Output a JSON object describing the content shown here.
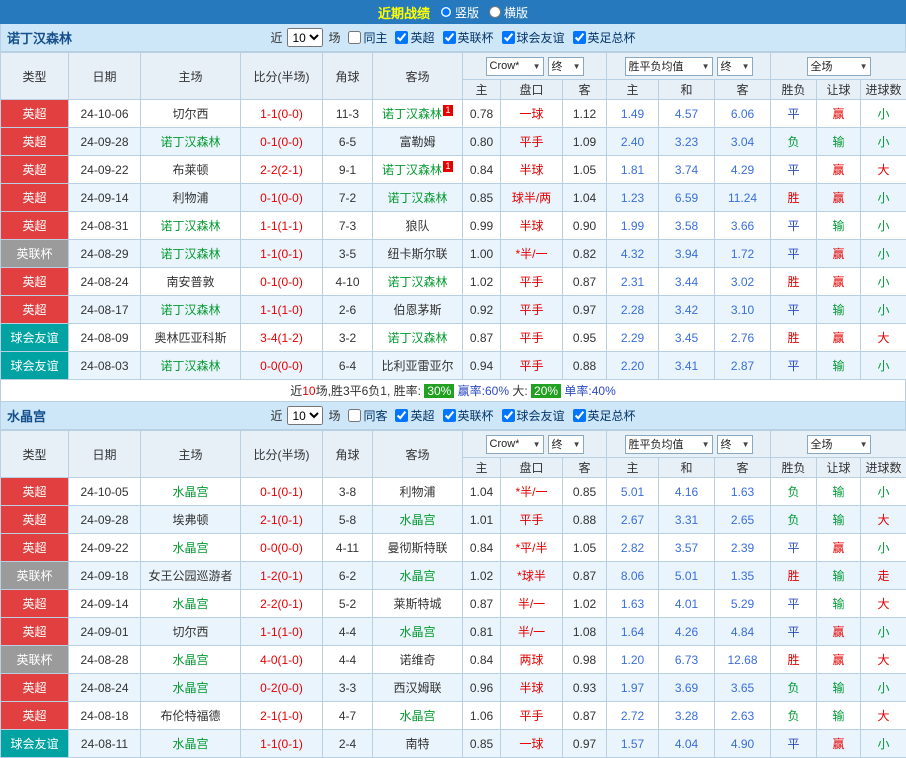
{
  "top_bar": {
    "title": "近期战绩",
    "options": [
      {
        "label": "竖版",
        "selected": true
      },
      {
        "label": "横版",
        "selected": false
      }
    ]
  },
  "table_header": {
    "static_cols": [
      "类型",
      "日期",
      "主场",
      "比分(半场)",
      "角球",
      "客场"
    ],
    "odds_source_select": "Crow*",
    "final_select": "终",
    "odds_sub": [
      "主",
      "盘口",
      "客"
    ],
    "avg_select": "胜平负均值",
    "avg_sub": [
      "主",
      "和",
      "客"
    ],
    "scope_select": "全场",
    "result_sub": [
      "胜负",
      "让球",
      "进球数"
    ]
  },
  "type_colors": {
    "英超": {
      "bg": "#e24040",
      "fg": "#ffffff"
    },
    "英联杯": {
      "bg": "#9b9b9b",
      "fg": "#ffffff"
    },
    "球会友谊": {
      "bg": "#00a2a2",
      "fg": "#ffffff"
    }
  },
  "result_colors": {
    "胜": "#e60000",
    "平": "#2b49c3",
    "负": "#019934",
    "赢": "#e60000",
    "输": "#019934",
    "大": "#e60000",
    "小": "#019934",
    "走": "#e60000"
  },
  "colors": {
    "focus_team": "#029a2f",
    "normal_team": "#333333"
  },
  "sections": [
    {
      "team": "诺丁汉森林",
      "filter": {
        "prefix": "近",
        "count": "10",
        "suffix": "场",
        "venue": {
          "label": "同主",
          "checked": false
        },
        "competitions": [
          {
            "label": "英超",
            "checked": true
          },
          {
            "label": "英联杯",
            "checked": true
          },
          {
            "label": "球会友谊",
            "checked": true
          },
          {
            "label": "英足总杯",
            "checked": true
          }
        ]
      },
      "rows": [
        {
          "type": "英超",
          "date": "24-10-06",
          "home": "切尔西",
          "home_focus": false,
          "score": "1-1(0-0)",
          "corner": "11-3",
          "away": "诺丁汉森林",
          "away_focus": true,
          "away_sup": "1",
          "odds": [
            "0.78",
            "一球",
            "1.12"
          ],
          "avg": [
            "1.49",
            "4.57",
            "6.06"
          ],
          "res": [
            "平",
            "赢",
            "小"
          ]
        },
        {
          "type": "英超",
          "date": "24-09-28",
          "home": "诺丁汉森林",
          "home_focus": true,
          "score": "0-1(0-0)",
          "corner": "6-5",
          "away": "富勒姆",
          "away_focus": false,
          "odds": [
            "0.80",
            "平手",
            "1.09"
          ],
          "avg": [
            "2.40",
            "3.23",
            "3.04"
          ],
          "res": [
            "负",
            "输",
            "小"
          ]
        },
        {
          "type": "英超",
          "date": "24-09-22",
          "home": "布莱顿",
          "home_focus": false,
          "score": "2-2(2-1)",
          "corner": "9-1",
          "away": "诺丁汉森林",
          "away_focus": true,
          "away_sup": "1",
          "odds": [
            "0.84",
            "半球",
            "1.05"
          ],
          "avg": [
            "1.81",
            "3.74",
            "4.29"
          ],
          "res": [
            "平",
            "赢",
            "大"
          ]
        },
        {
          "type": "英超",
          "date": "24-09-14",
          "home": "利物浦",
          "home_focus": false,
          "score": "0-1(0-0)",
          "corner": "7-2",
          "away": "诺丁汉森林",
          "away_focus": true,
          "odds": [
            "0.85",
            "球半/两",
            "1.04"
          ],
          "avg": [
            "1.23",
            "6.59",
            "11.24"
          ],
          "res": [
            "胜",
            "赢",
            "小"
          ]
        },
        {
          "type": "英超",
          "date": "24-08-31",
          "home": "诺丁汉森林",
          "home_focus": true,
          "score": "1-1(1-1)",
          "corner": "7-3",
          "away": "狼队",
          "away_focus": false,
          "odds": [
            "0.99",
            "半球",
            "0.90"
          ],
          "avg": [
            "1.99",
            "3.58",
            "3.66"
          ],
          "res": [
            "平",
            "输",
            "小"
          ]
        },
        {
          "type": "英联杯",
          "date": "24-08-29",
          "home": "诺丁汉森林",
          "home_focus": true,
          "score": "1-1(0-1)",
          "corner": "3-5",
          "away": "纽卡斯尔联",
          "away_focus": false,
          "odds": [
            "1.00",
            "*半/一",
            "0.82"
          ],
          "avg": [
            "4.32",
            "3.94",
            "1.72"
          ],
          "res": [
            "平",
            "赢",
            "小"
          ]
        },
        {
          "type": "英超",
          "date": "24-08-24",
          "home": "南安普敦",
          "home_focus": false,
          "score": "0-1(0-0)",
          "corner": "4-10",
          "away": "诺丁汉森林",
          "away_focus": true,
          "odds": [
            "1.02",
            "平手",
            "0.87"
          ],
          "avg": [
            "2.31",
            "3.44",
            "3.02"
          ],
          "res": [
            "胜",
            "赢",
            "小"
          ]
        },
        {
          "type": "英超",
          "date": "24-08-17",
          "home": "诺丁汉森林",
          "home_focus": true,
          "score": "1-1(1-0)",
          "corner": "2-6",
          "away": "伯恩茅斯",
          "away_focus": false,
          "odds": [
            "0.92",
            "平手",
            "0.97"
          ],
          "avg": [
            "2.28",
            "3.42",
            "3.10"
          ],
          "res": [
            "平",
            "输",
            "小"
          ]
        },
        {
          "type": "球会友谊",
          "date": "24-08-09",
          "home": "奥林匹亚科斯",
          "home_focus": false,
          "score": "3-4(1-2)",
          "corner": "3-2",
          "away": "诺丁汉森林",
          "away_focus": true,
          "odds": [
            "0.87",
            "平手",
            "0.95"
          ],
          "avg": [
            "2.29",
            "3.45",
            "2.76"
          ],
          "res": [
            "胜",
            "赢",
            "大"
          ]
        },
        {
          "type": "球会友谊",
          "date": "24-08-03",
          "home": "诺丁汉森林",
          "home_focus": true,
          "score": "0-0(0-0)",
          "corner": "6-4",
          "away": "比利亚雷亚尔",
          "away_focus": false,
          "odds": [
            "0.94",
            "平手",
            "0.88"
          ],
          "avg": [
            "2.20",
            "3.41",
            "2.87"
          ],
          "res": [
            "平",
            "输",
            "小"
          ]
        }
      ],
      "summary": [
        {
          "text": "近",
          "color": "#333333"
        },
        {
          "text": "10",
          "color": "#e60000"
        },
        {
          "text": "场,胜3平6负1, 胜率: ",
          "color": "#333333"
        },
        {
          "text": "30%",
          "color": "#ffffff",
          "bg": "#21a021"
        },
        {
          "text": " 赢率:60% ",
          "color": "#2b49c3"
        },
        {
          "text": "大: ",
          "color": "#333333"
        },
        {
          "text": "20%",
          "color": "#ffffff",
          "bg": "#21a021"
        },
        {
          "text": " 单率:40%",
          "color": "#2b49c3"
        }
      ]
    },
    {
      "team": "水晶宫",
      "filter": {
        "prefix": "近",
        "count": "10",
        "suffix": "场",
        "venue": {
          "label": "同客",
          "checked": false
        },
        "competitions": [
          {
            "label": "英超",
            "checked": true
          },
          {
            "label": "英联杯",
            "checked": true
          },
          {
            "label": "球会友谊",
            "checked": true
          },
          {
            "label": "英足总杯",
            "checked": true
          }
        ]
      },
      "rows": [
        {
          "type": "英超",
          "date": "24-10-05",
          "home": "水晶宫",
          "home_focus": true,
          "score": "0-1(0-1)",
          "corner": "3-8",
          "away": "利物浦",
          "away_focus": false,
          "odds": [
            "1.04",
            "*半/一",
            "0.85"
          ],
          "avg": [
            "5.01",
            "4.16",
            "1.63"
          ],
          "res": [
            "负",
            "输",
            "小"
          ]
        },
        {
          "type": "英超",
          "date": "24-09-28",
          "home": "埃弗顿",
          "home_focus": false,
          "score": "2-1(0-1)",
          "corner": "5-8",
          "away": "水晶宫",
          "away_focus": true,
          "odds": [
            "1.01",
            "平手",
            "0.88"
          ],
          "avg": [
            "2.67",
            "3.31",
            "2.65"
          ],
          "res": [
            "负",
            "输",
            "大"
          ]
        },
        {
          "type": "英超",
          "date": "24-09-22",
          "home": "水晶宫",
          "home_focus": true,
          "score": "0-0(0-0)",
          "corner": "4-11",
          "away": "曼彻斯特联",
          "away_focus": false,
          "odds": [
            "0.84",
            "*平/半",
            "1.05"
          ],
          "avg": [
            "2.82",
            "3.57",
            "2.39"
          ],
          "res": [
            "平",
            "赢",
            "小"
          ]
        },
        {
          "type": "英联杯",
          "date": "24-09-18",
          "home": "女王公园巡游者",
          "home_focus": false,
          "score": "1-2(0-1)",
          "corner": "6-2",
          "away": "水晶宫",
          "away_focus": true,
          "odds": [
            "1.02",
            "*球半",
            "0.87"
          ],
          "avg": [
            "8.06",
            "5.01",
            "1.35"
          ],
          "res": [
            "胜",
            "输",
            "走"
          ]
        },
        {
          "type": "英超",
          "date": "24-09-14",
          "home": "水晶宫",
          "home_focus": true,
          "score": "2-2(0-1)",
          "corner": "5-2",
          "away": "莱斯特城",
          "away_focus": false,
          "odds": [
            "0.87",
            "半/一",
            "1.02"
          ],
          "avg": [
            "1.63",
            "4.01",
            "5.29"
          ],
          "res": [
            "平",
            "输",
            "大"
          ]
        },
        {
          "type": "英超",
          "date": "24-09-01",
          "home": "切尔西",
          "home_focus": false,
          "score": "1-1(1-0)",
          "corner": "4-4",
          "away": "水晶宫",
          "away_focus": true,
          "odds": [
            "0.81",
            "半/一",
            "1.08"
          ],
          "avg": [
            "1.64",
            "4.26",
            "4.84"
          ],
          "res": [
            "平",
            "赢",
            "小"
          ]
        },
        {
          "type": "英联杯",
          "date": "24-08-28",
          "home": "水晶宫",
          "home_focus": true,
          "score": "4-0(1-0)",
          "corner": "4-4",
          "away": "诺维奇",
          "away_focus": false,
          "odds": [
            "0.84",
            "两球",
            "0.98"
          ],
          "avg": [
            "1.20",
            "6.73",
            "12.68"
          ],
          "res": [
            "胜",
            "赢",
            "大"
          ]
        },
        {
          "type": "英超",
          "date": "24-08-24",
          "home": "水晶宫",
          "home_focus": true,
          "score": "0-2(0-0)",
          "corner": "3-3",
          "away": "西汉姆联",
          "away_focus": false,
          "odds": [
            "0.96",
            "半球",
            "0.93"
          ],
          "avg": [
            "1.97",
            "3.69",
            "3.65"
          ],
          "res": [
            "负",
            "输",
            "小"
          ]
        },
        {
          "type": "英超",
          "date": "24-08-18",
          "home": "布伦特福德",
          "home_focus": false,
          "score": "2-1(1-0)",
          "corner": "4-7",
          "away": "水晶宫",
          "away_focus": true,
          "odds": [
            "1.06",
            "平手",
            "0.87"
          ],
          "avg": [
            "2.72",
            "3.28",
            "2.63"
          ],
          "res": [
            "负",
            "输",
            "大"
          ]
        },
        {
          "type": "球会友谊",
          "date": "24-08-11",
          "home": "水晶宫",
          "home_focus": true,
          "score": "1-1(0-1)",
          "corner": "2-4",
          "away": "南特",
          "away_focus": false,
          "odds": [
            "0.85",
            "一球",
            "0.97"
          ],
          "avg": [
            "1.57",
            "4.04",
            "4.90"
          ],
          "res": [
            "平",
            "赢",
            "小"
          ]
        }
      ]
    }
  ]
}
